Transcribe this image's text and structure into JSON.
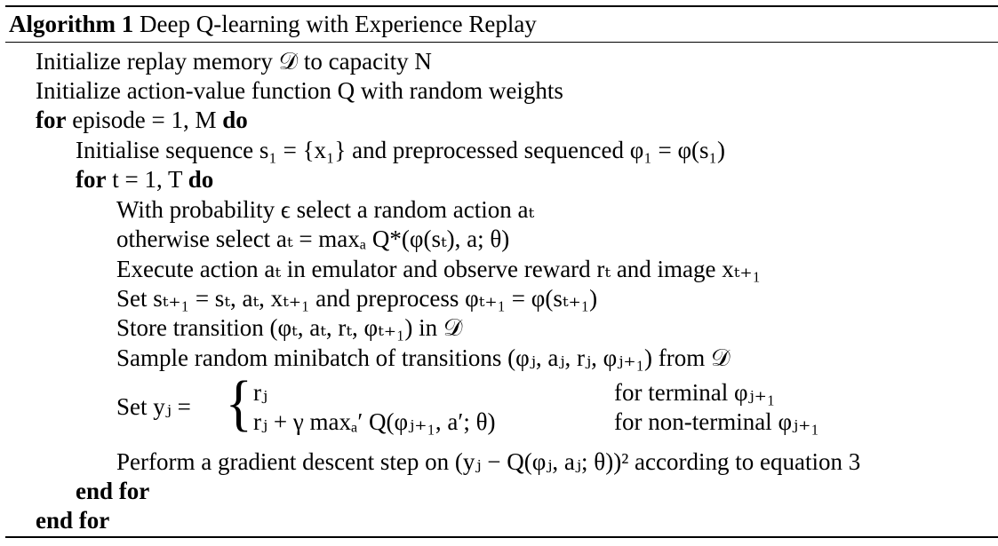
{
  "algorithm": {
    "label": "Algorithm 1",
    "title": "Deep Q-learning with Experience Replay"
  },
  "lines": {
    "l1": "Initialize replay memory 𝒟 to capacity N",
    "l2": "Initialize action-value function Q with random weights",
    "l3_kw1": "for",
    "l3_text": "episode = 1, M",
    "l3_kw2": "do",
    "l4": "Initialise sequence s₁ = {x₁} and preprocessed sequenced φ₁ = φ(s₁)",
    "l5_kw1": "for",
    "l5_text": "t = 1, T",
    "l5_kw2": "do",
    "l6": "With probability ϵ select a random action aₜ",
    "l7": "otherwise select aₜ = maxₐ Q*(φ(sₜ), a; θ)",
    "l8": "Execute action aₜ in emulator and observe reward rₜ and image xₜ₊₁",
    "l9": "Set sₜ₊₁ = sₜ, aₜ, xₜ₊₁ and preprocess φₜ₊₁ = φ(sₜ₊₁)",
    "l10": "Store transition (φₜ, aₜ, rₜ, φₜ₊₁) in 𝒟",
    "l11": "Sample random minibatch of transitions (φⱼ, aⱼ, rⱼ, φⱼ₊₁) from 𝒟",
    "l12_lhs": "Set yⱼ =",
    "l12_case1_expr": "rⱼ",
    "l12_case1_cond": "for terminal φⱼ₊₁",
    "l12_case2_expr": "rⱼ + γ maxₐ′ Q(φⱼ₊₁, a′; θ)",
    "l12_case2_cond": "for non-terminal φⱼ₊₁",
    "l13": "Perform a gradient descent step on (yⱼ − Q(φⱼ, aⱼ; θ))² according to equation 3",
    "l14": "end for",
    "l15": "end for"
  }
}
